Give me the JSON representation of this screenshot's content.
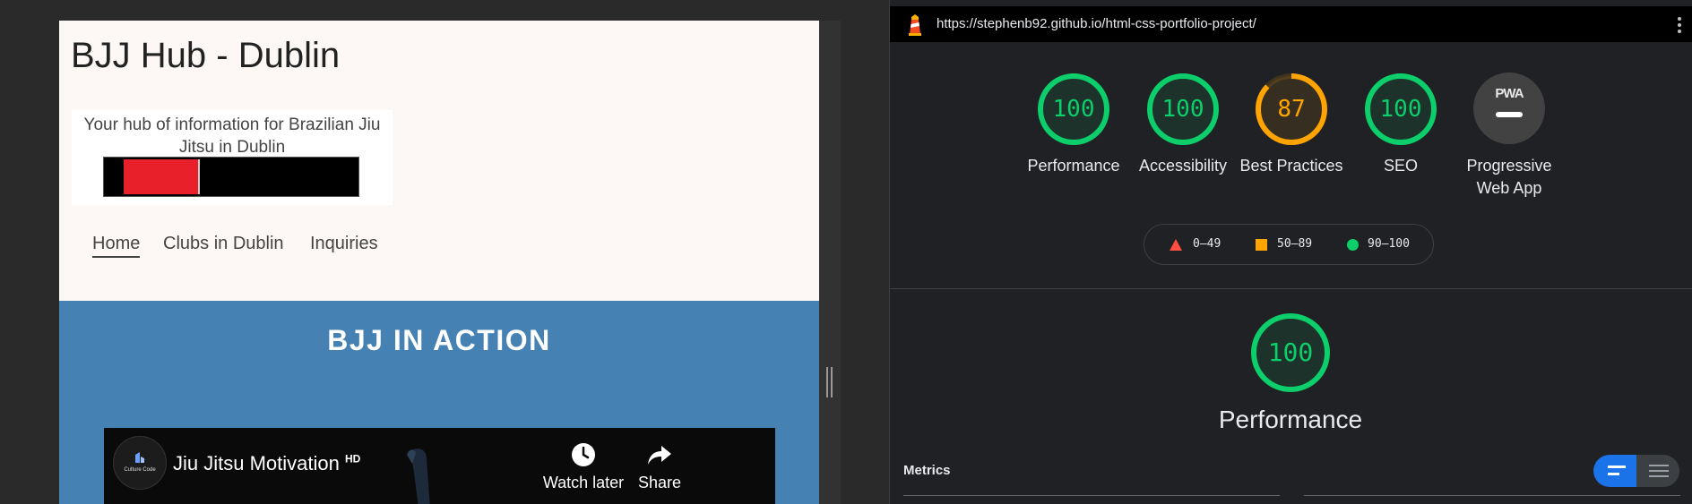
{
  "site": {
    "title": "BJJ Hub - Dublin",
    "tagline": "Your hub of information for Brazilian Jiu Jitsu in Dublin",
    "nav": [
      "Home",
      "Clubs in Dublin",
      "Inquiries"
    ],
    "section_title": "BJJ IN ACTION"
  },
  "video": {
    "title": "Jiu Jitsu Motivation",
    "hd_badge": "HD",
    "channel_name": "Culture Code",
    "watch_later": "Watch later",
    "share": "Share"
  },
  "lighthouse": {
    "url": "https://stephenb92.github.io/html-css-portfolio-project/",
    "categories": [
      {
        "label": "Performance",
        "score": "100",
        "status": "pass"
      },
      {
        "label": "Accessibility",
        "score": "100",
        "status": "pass"
      },
      {
        "label": "Best Practices",
        "score": "87",
        "status": "average"
      },
      {
        "label": "SEO",
        "score": "100",
        "status": "pass"
      },
      {
        "label": "Progressive Web App",
        "badge": "PWA"
      }
    ],
    "legend": [
      "0–49",
      "50–89",
      "90–100"
    ],
    "summary": {
      "label": "Performance",
      "score": "100"
    },
    "metrics_heading": "Metrics"
  },
  "colors": {
    "pass": "#0cce6b",
    "average": "#ffa400",
    "fail": "#ff4e42",
    "band": "#4681b4",
    "toggle_active": "#1a73e8"
  }
}
